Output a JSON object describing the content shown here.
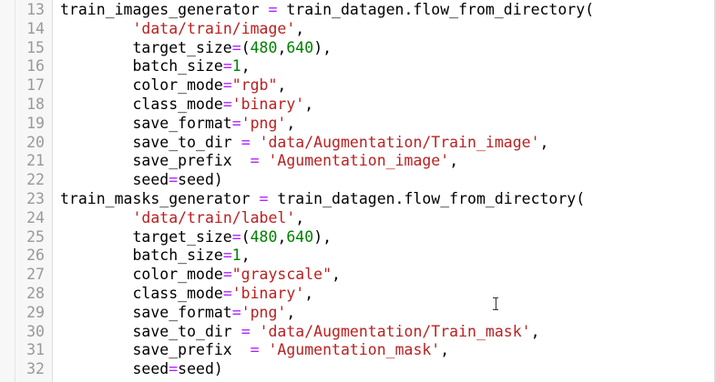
{
  "editor": {
    "lines": [
      {
        "num": "13",
        "tokens": [
          [
            "train_images_generator ",
            "plain"
          ],
          [
            "=",
            "op"
          ],
          [
            " train_datagen.flow_from_directory(",
            "plain"
          ]
        ]
      },
      {
        "num": "14",
        "tokens": [
          [
            "        ",
            "plain"
          ],
          [
            "'data/train/image'",
            "str"
          ],
          [
            ",",
            "plain"
          ]
        ]
      },
      {
        "num": "15",
        "tokens": [
          [
            "        target_size",
            "plain"
          ],
          [
            "=",
            "op"
          ],
          [
            "(",
            "plain"
          ],
          [
            "480",
            "num"
          ],
          [
            ",",
            "plain"
          ],
          [
            "640",
            "num"
          ],
          [
            "),",
            "plain"
          ]
        ]
      },
      {
        "num": "16",
        "tokens": [
          [
            "        batch_size",
            "plain"
          ],
          [
            "=",
            "op"
          ],
          [
            "1",
            "num"
          ],
          [
            ",",
            "plain"
          ]
        ]
      },
      {
        "num": "17",
        "tokens": [
          [
            "        color_mode",
            "plain"
          ],
          [
            "=",
            "op"
          ],
          [
            "\"rgb\"",
            "str"
          ],
          [
            ",",
            "plain"
          ]
        ]
      },
      {
        "num": "18",
        "tokens": [
          [
            "        class_mode",
            "plain"
          ],
          [
            "=",
            "op"
          ],
          [
            "'binary'",
            "str"
          ],
          [
            ",",
            "plain"
          ]
        ]
      },
      {
        "num": "19",
        "tokens": [
          [
            "        save_format",
            "plain"
          ],
          [
            "=",
            "op"
          ],
          [
            "'png'",
            "str"
          ],
          [
            ",",
            "plain"
          ]
        ]
      },
      {
        "num": "20",
        "tokens": [
          [
            "        save_to_dir ",
            "plain"
          ],
          [
            "=",
            "op"
          ],
          [
            " ",
            "plain"
          ],
          [
            "'data/Augmentation/Train_image'",
            "str"
          ],
          [
            ",",
            "plain"
          ]
        ]
      },
      {
        "num": "21",
        "tokens": [
          [
            "        save_prefix  ",
            "plain"
          ],
          [
            "=",
            "op"
          ],
          [
            " ",
            "plain"
          ],
          [
            "'Agumentation_image'",
            "str"
          ],
          [
            ",",
            "plain"
          ]
        ]
      },
      {
        "num": "22",
        "tokens": [
          [
            "        seed",
            "plain"
          ],
          [
            "=",
            "op"
          ],
          [
            "seed)",
            "plain"
          ]
        ]
      },
      {
        "num": "23",
        "tokens": [
          [
            "train_masks_generator ",
            "plain"
          ],
          [
            "=",
            "op"
          ],
          [
            " train_datagen.flow_from_directory(",
            "plain"
          ]
        ]
      },
      {
        "num": "24",
        "tokens": [
          [
            "        ",
            "plain"
          ],
          [
            "'data/train/label'",
            "str"
          ],
          [
            ",",
            "plain"
          ]
        ]
      },
      {
        "num": "25",
        "tokens": [
          [
            "        target_size",
            "plain"
          ],
          [
            "=",
            "op"
          ],
          [
            "(",
            "plain"
          ],
          [
            "480",
            "num"
          ],
          [
            ",",
            "plain"
          ],
          [
            "640",
            "num"
          ],
          [
            "),",
            "plain"
          ]
        ]
      },
      {
        "num": "26",
        "tokens": [
          [
            "        batch_size",
            "plain"
          ],
          [
            "=",
            "op"
          ],
          [
            "1",
            "num"
          ],
          [
            ",",
            "plain"
          ]
        ]
      },
      {
        "num": "27",
        "tokens": [
          [
            "        color_mode",
            "plain"
          ],
          [
            "=",
            "op"
          ],
          [
            "\"grayscale\"",
            "str"
          ],
          [
            ",",
            "plain"
          ]
        ]
      },
      {
        "num": "28",
        "tokens": [
          [
            "        class_mode",
            "plain"
          ],
          [
            "=",
            "op"
          ],
          [
            "'binary'",
            "str"
          ],
          [
            ",",
            "plain"
          ]
        ]
      },
      {
        "num": "29",
        "tokens": [
          [
            "        save_format",
            "plain"
          ],
          [
            "=",
            "op"
          ],
          [
            "'png'",
            "str"
          ],
          [
            ",",
            "plain"
          ]
        ]
      },
      {
        "num": "30",
        "tokens": [
          [
            "        save_to_dir ",
            "plain"
          ],
          [
            "=",
            "op"
          ],
          [
            " ",
            "plain"
          ],
          [
            "'data/Augmentation/Train_mask'",
            "str"
          ],
          [
            ",",
            "plain"
          ]
        ]
      },
      {
        "num": "31",
        "tokens": [
          [
            "        save_prefix  ",
            "plain"
          ],
          [
            "=",
            "op"
          ],
          [
            " ",
            "plain"
          ],
          [
            "'Agumentation_mask'",
            "str"
          ],
          [
            ",",
            "plain"
          ]
        ]
      },
      {
        "num": "32",
        "tokens": [
          [
            "        seed",
            "plain"
          ],
          [
            "=",
            "op"
          ],
          [
            "seed)",
            "plain"
          ]
        ]
      }
    ]
  },
  "cursor": {
    "icon": "i-beam-cursor-icon"
  },
  "colors": {
    "operator": "#aa22ff",
    "string": "#ba2121",
    "number": "#008000",
    "text": "#000000",
    "line_number": "#999999",
    "gutter_bg": "#f7f7f7"
  }
}
